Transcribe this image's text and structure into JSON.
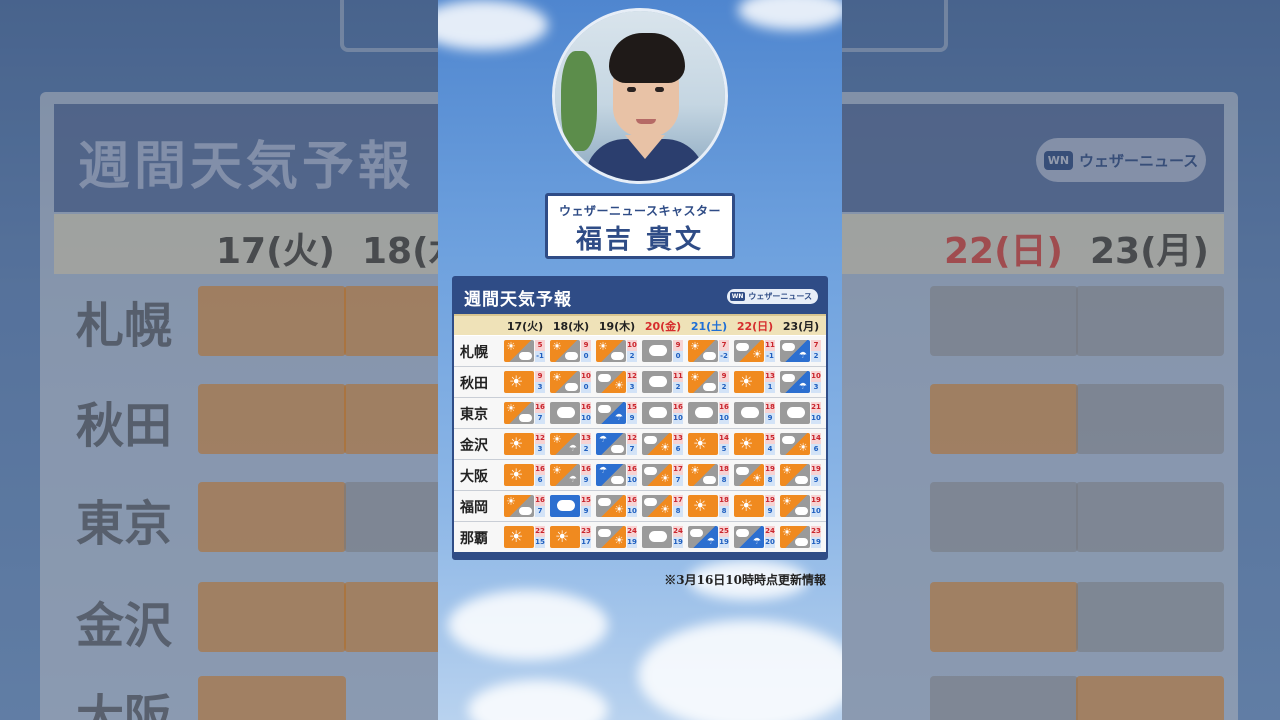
{
  "caster": {
    "role": "ウェザーニュースキャスター",
    "name": "福吉 貴文"
  },
  "forecast": {
    "title": "週間天気予報",
    "logo": "ウェザーニュース",
    "logo_mark": "WN",
    "days": [
      "17(火)",
      "18(水)",
      "19(木)",
      "20(金)",
      "21(土)",
      "22(日)",
      "23(月)"
    ],
    "day_types": [
      "weekday",
      "weekday",
      "weekday",
      "holiday",
      "saturday",
      "holiday",
      "weekday"
    ],
    "cities": [
      {
        "name": "札幌",
        "cells": [
          {
            "icon": "sun-cloud",
            "hi": "5",
            "lo": "-1"
          },
          {
            "icon": "sun-cloud",
            "hi": "9",
            "lo": "0"
          },
          {
            "icon": "sun-cloud",
            "hi": "10",
            "lo": "2"
          },
          {
            "icon": "cloud",
            "hi": "9",
            "lo": "0"
          },
          {
            "icon": "sun-cloud",
            "hi": "7",
            "lo": "-2"
          },
          {
            "icon": "cloud-sun",
            "hi": "11",
            "lo": "-1"
          },
          {
            "icon": "cloud-rain",
            "hi": "7",
            "lo": "2"
          }
        ]
      },
      {
        "name": "秋田",
        "cells": [
          {
            "icon": "sun",
            "hi": "9",
            "lo": "3"
          },
          {
            "icon": "sun-cloud",
            "hi": "10",
            "lo": "0"
          },
          {
            "icon": "cloud-sun",
            "hi": "12",
            "lo": "3"
          },
          {
            "icon": "cloud",
            "hi": "11",
            "lo": "2"
          },
          {
            "icon": "sun-cloud",
            "hi": "9",
            "lo": "2"
          },
          {
            "icon": "sun",
            "hi": "13",
            "lo": "1"
          },
          {
            "icon": "cloud-rain",
            "hi": "10",
            "lo": "3"
          }
        ]
      },
      {
        "name": "東京",
        "cells": [
          {
            "icon": "sun-cloud",
            "hi": "16",
            "lo": "7"
          },
          {
            "icon": "cloud",
            "hi": "16",
            "lo": "10"
          },
          {
            "icon": "cloud-rain",
            "hi": "15",
            "lo": "9"
          },
          {
            "icon": "cloud",
            "hi": "16",
            "lo": "10"
          },
          {
            "icon": "cloud",
            "hi": "16",
            "lo": "10"
          },
          {
            "icon": "cloud",
            "hi": "18",
            "lo": "9"
          },
          {
            "icon": "cloud",
            "hi": "21",
            "lo": "10"
          }
        ]
      },
      {
        "name": "金沢",
        "cells": [
          {
            "icon": "sun",
            "hi": "12",
            "lo": "3"
          },
          {
            "icon": "sun-rain",
            "hi": "13",
            "lo": "2"
          },
          {
            "icon": "rain-cloud",
            "hi": "12",
            "lo": "7"
          },
          {
            "icon": "cloud-sun",
            "hi": "13",
            "lo": "6"
          },
          {
            "icon": "sun",
            "hi": "14",
            "lo": "5"
          },
          {
            "icon": "sun",
            "hi": "15",
            "lo": "4"
          },
          {
            "icon": "cloud-sun",
            "hi": "14",
            "lo": "6"
          }
        ]
      },
      {
        "name": "大阪",
        "cells": [
          {
            "icon": "sun",
            "hi": "16",
            "lo": "6"
          },
          {
            "icon": "sun-rain",
            "hi": "16",
            "lo": "9"
          },
          {
            "icon": "rain-cloud",
            "hi": "16",
            "lo": "10"
          },
          {
            "icon": "cloud-sun",
            "hi": "17",
            "lo": "7"
          },
          {
            "icon": "sun-cloud",
            "hi": "18",
            "lo": "8"
          },
          {
            "icon": "cloud-sun",
            "hi": "19",
            "lo": "8"
          },
          {
            "icon": "sun-cloud",
            "hi": "19",
            "lo": "9"
          }
        ]
      },
      {
        "name": "福岡",
        "cells": [
          {
            "icon": "sun-cloud",
            "hi": "16",
            "lo": "7"
          },
          {
            "icon": "rain",
            "hi": "15",
            "lo": "9"
          },
          {
            "icon": "cloud-sun",
            "hi": "16",
            "lo": "10"
          },
          {
            "icon": "cloud-sun",
            "hi": "17",
            "lo": "8"
          },
          {
            "icon": "sun",
            "hi": "18",
            "lo": "8"
          },
          {
            "icon": "sun",
            "hi": "19",
            "lo": "9"
          },
          {
            "icon": "sun-cloud",
            "hi": "19",
            "lo": "10"
          }
        ]
      },
      {
        "name": "那覇",
        "cells": [
          {
            "icon": "sun",
            "hi": "22",
            "lo": "15"
          },
          {
            "icon": "sun",
            "hi": "23",
            "lo": "17"
          },
          {
            "icon": "cloud-sun",
            "hi": "24",
            "lo": "19"
          },
          {
            "icon": "cloud",
            "hi": "24",
            "lo": "19"
          },
          {
            "icon": "cloud-rain",
            "hi": "25",
            "lo": "19"
          },
          {
            "icon": "cloud-rain",
            "hi": "24",
            "lo": "20"
          },
          {
            "icon": "sun-cloud",
            "hi": "23",
            "lo": "19"
          }
        ]
      }
    ]
  },
  "note": "※3月16日10時時点更新情報",
  "colors": {
    "navy": "#2f4c86",
    "sun": "#f08a1f",
    "cloud": "#9a9a9a",
    "rain": "#2c6fd0",
    "hi": "#c9242c",
    "lo": "#1f5fbf"
  }
}
